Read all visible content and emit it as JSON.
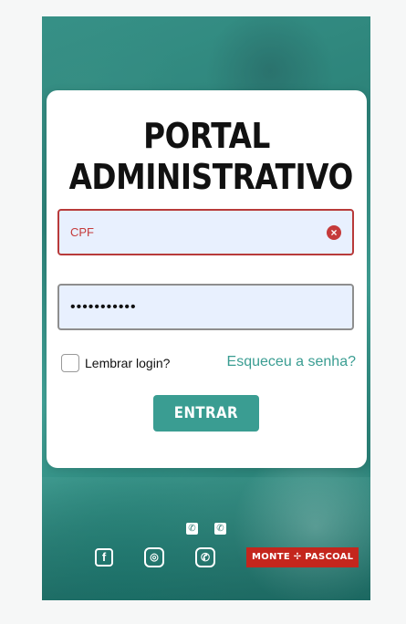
{
  "login": {
    "title_line1": "PORTAL",
    "title_line2": "ADMINISTRATIVO",
    "cpf_placeholder": "CPF",
    "password_value": "•••••••••••",
    "remember_label": "Lembrar login?",
    "forgot_label": "Esqueceu a senha?",
    "submit_label": "ENTRAR"
  },
  "footer": {
    "brand_label": "MONTE ✢ PASCOAL",
    "icons": [
      "phone-icon",
      "phone-icon",
      "facebook-icon",
      "instagram-icon",
      "whatsapp-icon"
    ]
  },
  "colors": {
    "accent": "#3a9d92",
    "error": "#c53a3a",
    "brand": "#c4261d",
    "input_bg": "#e8f0fe"
  }
}
